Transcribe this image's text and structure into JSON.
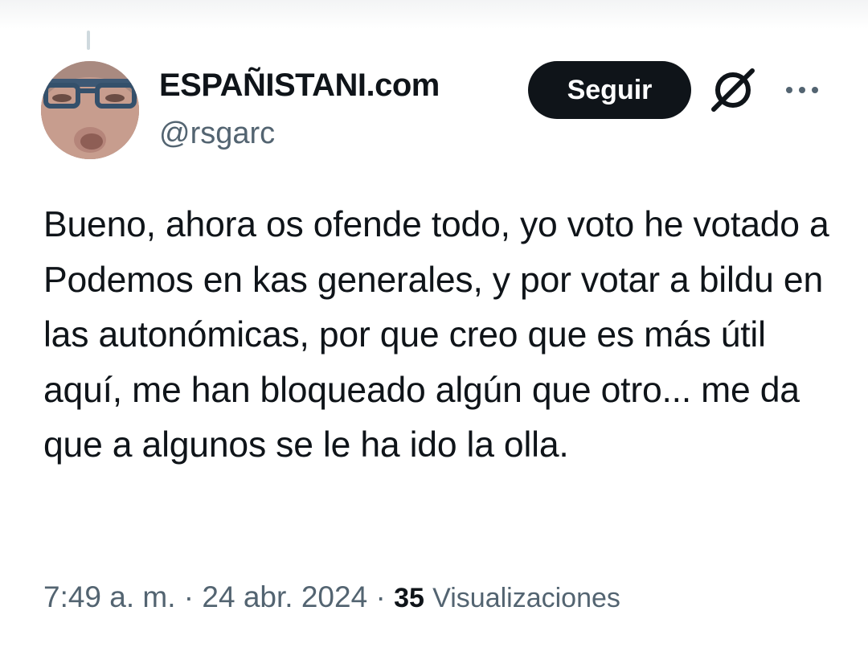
{
  "author": {
    "display_name": "ESPAÑISTANI.com",
    "handle": "@rsgarc"
  },
  "actions": {
    "follow_label": "Seguir"
  },
  "tweet": {
    "text": "Bueno, ahora os ofende todo, yo voto he votado a Podemos en kas generales, y por votar a bildu en las autonómicas, por que creo que es más útil aquí, me han bloqueado algún que otro... me da que a algunos se le ha ido la olla."
  },
  "meta": {
    "time": "7:49 a. m.",
    "separator": " · ",
    "date": "24 abr. 2024",
    "views_count": "35",
    "views_label": "Visualizaciones"
  },
  "icons": {
    "grok": "grok-icon",
    "more": "more-icon"
  },
  "colors": {
    "text_primary": "#0f1419",
    "text_secondary": "#536471",
    "button_bg": "#0f1419",
    "button_text": "#ffffff"
  }
}
